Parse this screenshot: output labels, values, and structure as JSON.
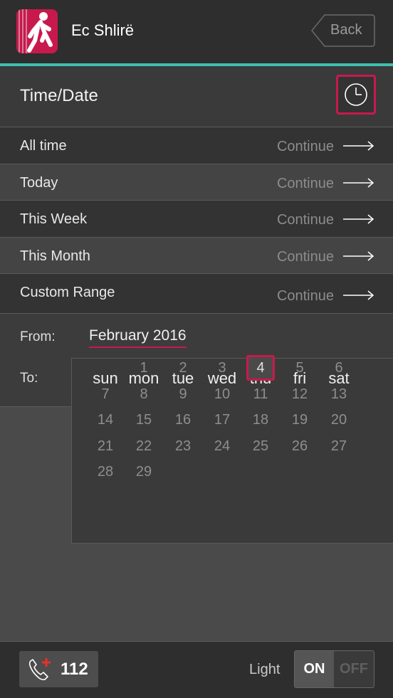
{
  "header": {
    "app_title": "Ec Shlirë",
    "back_label": "Back",
    "logo_icon": "walking-person-icon"
  },
  "section": {
    "title": "Time/Date",
    "clock_icon": "clock-icon"
  },
  "options": [
    {
      "label": "All time",
      "action": "Continue"
    },
    {
      "label": "Today",
      "action": "Continue"
    },
    {
      "label": "This Week",
      "action": "Continue"
    },
    {
      "label": "This Month",
      "action": "Continue"
    },
    {
      "label": "Custom Range",
      "action": "Continue"
    }
  ],
  "range": {
    "from_label": "From:",
    "from_value": "February 2016",
    "to_label": "To:"
  },
  "calendar": {
    "weekdays": [
      "sun",
      "mon",
      "tue",
      "wed",
      "thu",
      "fri",
      "sat"
    ],
    "weeks": [
      [
        "",
        "1",
        "2",
        "3",
        "4",
        "5",
        "6"
      ],
      [
        "7",
        "8",
        "9",
        "10",
        "11",
        "12",
        "13"
      ],
      [
        "14",
        "15",
        "16",
        "17",
        "18",
        "19",
        "20"
      ],
      [
        "21",
        "22",
        "23",
        "24",
        "25",
        "26",
        "27"
      ],
      [
        "28",
        "29",
        "",
        "",
        "",
        "",
        ""
      ]
    ],
    "selected_day": "4"
  },
  "footer": {
    "emergency_number": "112",
    "emergency_icon": "phone-plus-icon",
    "light_label": "Light",
    "toggle_on": "ON",
    "toggle_off": "OFF",
    "light_state": "ON"
  },
  "colors": {
    "accent": "#c8194d",
    "teal": "#3dbfb0"
  }
}
